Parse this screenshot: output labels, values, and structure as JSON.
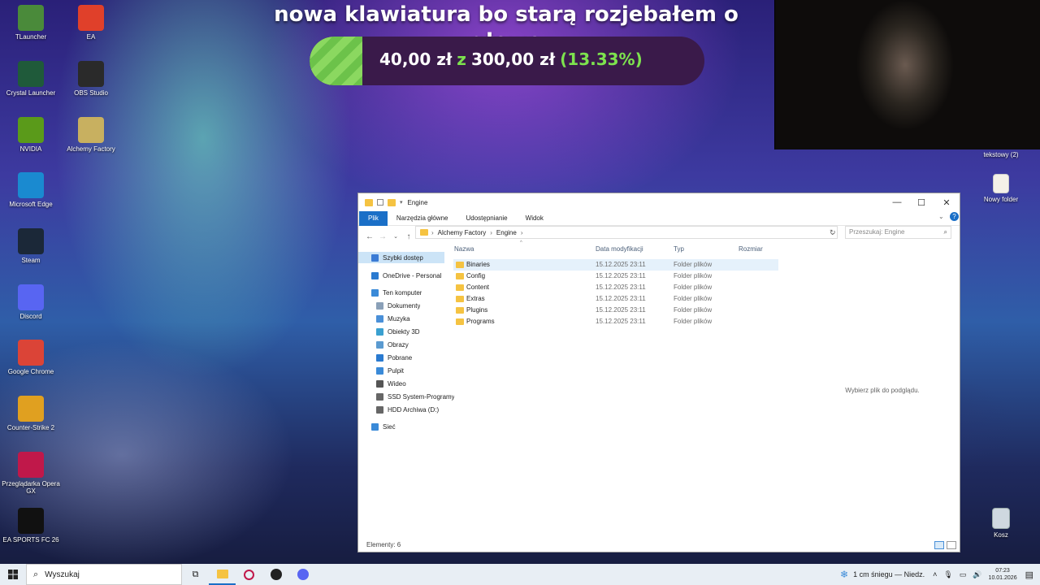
{
  "banner": {
    "title": "nowa klawiatura bo starą rozjebałem o głowe",
    "amount": "40,00 zł",
    "connector": "z",
    "goal": "300,00 zł",
    "percent": "(13.33%)",
    "progress_fraction": 0.1333
  },
  "desktop_left": [
    {
      "label": "TLauncher",
      "icon": "tlauncher-icon",
      "color": "#4a8a3a"
    },
    {
      "label": "EA",
      "icon": "ea-icon",
      "color": "#e0402a"
    },
    {
      "label": "Crystal Launcher",
      "icon": "crystal-launcher-icon",
      "color": "#1f5a3a"
    },
    {
      "label": "OBS Studio",
      "icon": "obs-icon",
      "color": "#2a2a2a"
    },
    {
      "label": "NVIDIA",
      "icon": "nvidia-icon",
      "color": "#5a9a1a"
    },
    {
      "label": "Alchemy Factory",
      "icon": "alchemy-factory-icon",
      "color": "#c8b060"
    },
    {
      "label": "Microsoft Edge",
      "icon": "edge-icon",
      "color": "#1a8ad0"
    },
    {
      "label": "Steam",
      "icon": "steam-icon",
      "color": "#1b2838"
    },
    {
      "label": "Discord",
      "icon": "discord-icon",
      "color": "#5865f2"
    },
    {
      "label": "Google Chrome",
      "icon": "chrome-icon",
      "color": "#db4437"
    },
    {
      "label": "Counter-Strike 2",
      "icon": "cs2-icon",
      "color": "#e0a020"
    },
    {
      "label": "Przeglądarka Opera GX",
      "icon": "opera-gx-icon",
      "color": "#c0184a"
    },
    {
      "label": "EA SPORTS FC 26",
      "icon": "fc26-icon",
      "color": "#111111"
    }
  ],
  "desktop_right": [
    {
      "label": "tekstowy (2)",
      "icon": "text-file-icon"
    },
    {
      "label": "Nowy folder",
      "icon": "folder-icon"
    },
    {
      "label": "Kosz",
      "icon": "recycle-bin-icon"
    }
  ],
  "explorer": {
    "title": "Engine",
    "ribbon_tabs": [
      "Plik",
      "Narzędzia główne",
      "Udostępnianie",
      "Widok"
    ],
    "breadcrumb": [
      "Alchemy Factory",
      "Engine"
    ],
    "search_placeholder": "Przeszukaj: Engine",
    "nav": [
      {
        "label": "Szybki dostęp",
        "icon": "star-icon",
        "color": "#3a7bd5"
      },
      {
        "label": "OneDrive - Personal",
        "icon": "cloud-icon",
        "color": "#2a7ad0"
      },
      {
        "label": "Ten komputer",
        "icon": "computer-icon",
        "color": "#3a8ad8"
      },
      {
        "label": "Dokumenty",
        "icon": "documents-icon",
        "color": "#8aa0b8"
      },
      {
        "label": "Muzyka",
        "icon": "music-icon",
        "color": "#4a90d8"
      },
      {
        "label": "Obiekty 3D",
        "icon": "3d-objects-icon",
        "color": "#3aa0d0"
      },
      {
        "label": "Obrazy",
        "icon": "pictures-icon",
        "color": "#5a9ad0"
      },
      {
        "label": "Pobrane",
        "icon": "downloads-icon",
        "color": "#2a7ad0"
      },
      {
        "label": "Pulpit",
        "icon": "desktop-icon",
        "color": "#3a8ad8"
      },
      {
        "label": "Wideo",
        "icon": "video-icon",
        "color": "#555555"
      },
      {
        "label": "SSD System-Programy (C:)",
        "icon": "drive-icon",
        "color": "#666666"
      },
      {
        "label": "HDD Archiwa (D:)",
        "icon": "drive-icon",
        "color": "#666666"
      },
      {
        "label": "Sieć",
        "icon": "network-icon",
        "color": "#3a8ad8"
      }
    ],
    "columns": [
      "Nazwa",
      "Data modyfikacji",
      "Typ",
      "Rozmiar"
    ],
    "files": [
      {
        "name": "Binaries",
        "date": "15.12.2025 23:11",
        "type": "Folder plików"
      },
      {
        "name": "Config",
        "date": "15.12.2025 23:11",
        "type": "Folder plików"
      },
      {
        "name": "Content",
        "date": "15.12.2025 23:11",
        "type": "Folder plików"
      },
      {
        "name": "Extras",
        "date": "15.12.2025 23:11",
        "type": "Folder plików"
      },
      {
        "name": "Plugins",
        "date": "15.12.2025 23:11",
        "type": "Folder plików"
      },
      {
        "name": "Programs",
        "date": "15.12.2025 23:11",
        "type": "Folder plików"
      }
    ],
    "preview_text": "Wybierz plik do podglądu.",
    "status": "Elementy: 6"
  },
  "taskbar": {
    "search_label": "Wyszukaj",
    "weather": "1 cm śniegu — Niedz.",
    "time": "07:23",
    "date": "10.01.2026",
    "accent": "#1a6fc7"
  }
}
